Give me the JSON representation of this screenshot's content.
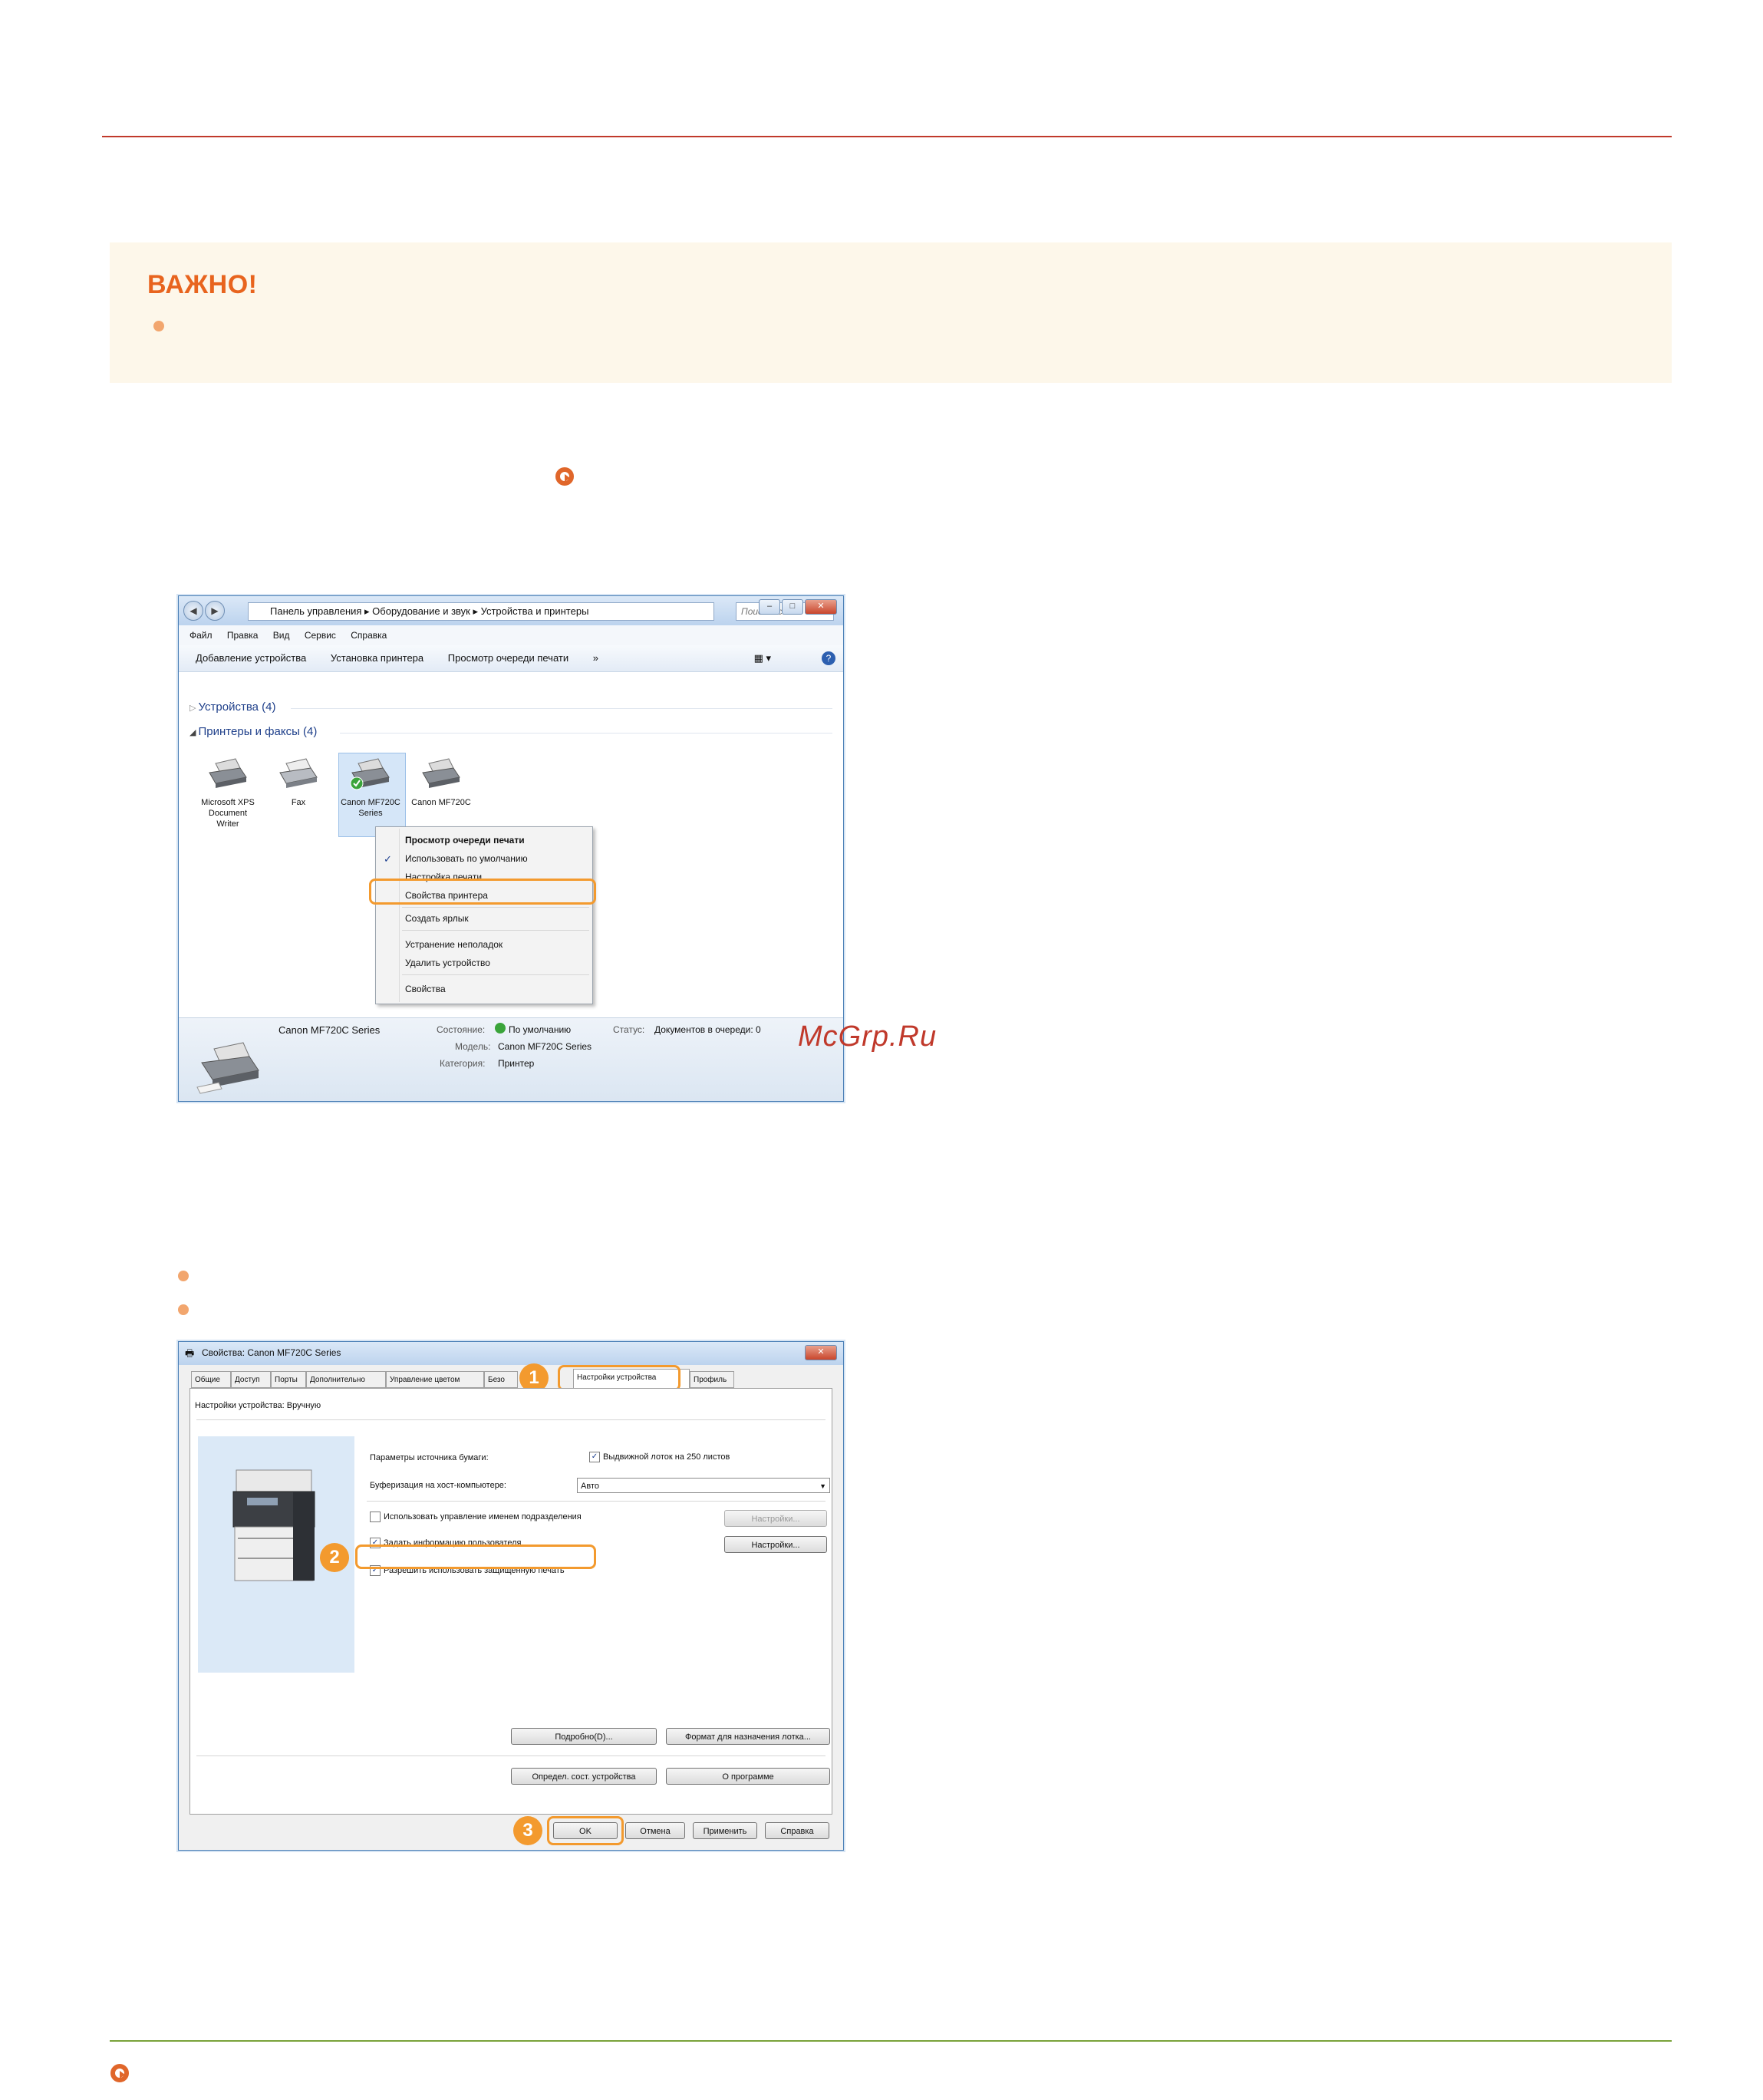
{
  "important": {
    "title": "ВАЖНО!"
  },
  "explorer": {
    "breadcrumb": "Панель управления ▸ Оборудование и звук ▸ Устройства и принтеры",
    "search_placeholder": "Поиск: Ус...",
    "menu": [
      "Файл",
      "Правка",
      "Вид",
      "Сервис",
      "Справка"
    ],
    "commands": [
      "Добавление устройства",
      "Установка принтера",
      "Просмотр очереди печати",
      "»"
    ],
    "group_devices": "Устройства (4)",
    "group_printers": "Принтеры и факсы (4)",
    "printers": [
      {
        "label": "Microsoft XPS Document Writer"
      },
      {
        "label": "Fax"
      },
      {
        "label": "Canon MF720C Series"
      },
      {
        "label": "Canon MF720C"
      }
    ],
    "context_menu": [
      "Просмотр очереди печати",
      "Использовать по умолчанию",
      "Настройка печати",
      "Свойства принтера",
      "Создать ярлык",
      "Устранение неполадок",
      "Удалить устройство",
      "Свойства"
    ],
    "details": {
      "name": "Canon MF720C Series",
      "state_label": "Состояние:",
      "state_value": "По умолчанию",
      "status_label": "Статус:",
      "status_value": "Документов в очереди: 0",
      "model_label": "Модель:",
      "model_value": "Canon MF720C Series",
      "category_label": "Категория:",
      "category_value": "Принтер"
    }
  },
  "watermark": "McGrp.Ru",
  "properties": {
    "title": "Свойства: Canon MF720C Series",
    "tabs": [
      "Общие",
      "Доступ",
      "Порты",
      "Дополнительно",
      "Управление цветом",
      "Безо",
      "Настройки устройства",
      "Профиль"
    ],
    "header_label": "Настройки устройства: Вручную",
    "paper_source_label": "Параметры источника бумаги:",
    "paper_source_value": "Выдвижной лоток на 250 листов",
    "spooling_label": "Буферизация на хост-компьютере:",
    "spooling_value": "Авто",
    "dept_id_label": "Использовать управление именем подразделения",
    "user_info_label": "Задать информацию пользователя",
    "secure_print_label": "Разрешить использовать защищенную печать",
    "settings_button": "Настройки...",
    "details_button": "Подробно(D)...",
    "format_button": "Формат для назначения лотка...",
    "device_status_button": "Определ. сост. устройства",
    "about_button": "О программе",
    "ok_button": "OK",
    "cancel_button": "Отмена",
    "apply_button": "Применить",
    "help_button": "Справка"
  },
  "callouts": [
    "1",
    "2",
    "3"
  ]
}
